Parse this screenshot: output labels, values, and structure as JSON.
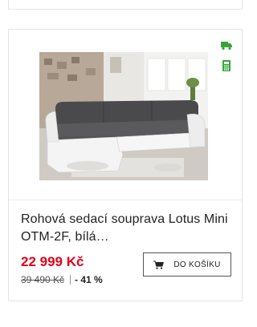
{
  "product": {
    "title": "Rohová sedací souprava Lotus Mini OTM-2F, bílá…",
    "price": "22 999 Kč",
    "old_price": "39 490 Kč",
    "discount": "- 41 %",
    "cart_label": "DO KOŠÍKU",
    "image_alt": "corner sofa"
  },
  "icons": {
    "delivery": "truck-icon",
    "installment": "calculator-icon",
    "cart": "cart-icon"
  },
  "colors": {
    "price": "#e3001b",
    "icon_green": "#37a537"
  }
}
